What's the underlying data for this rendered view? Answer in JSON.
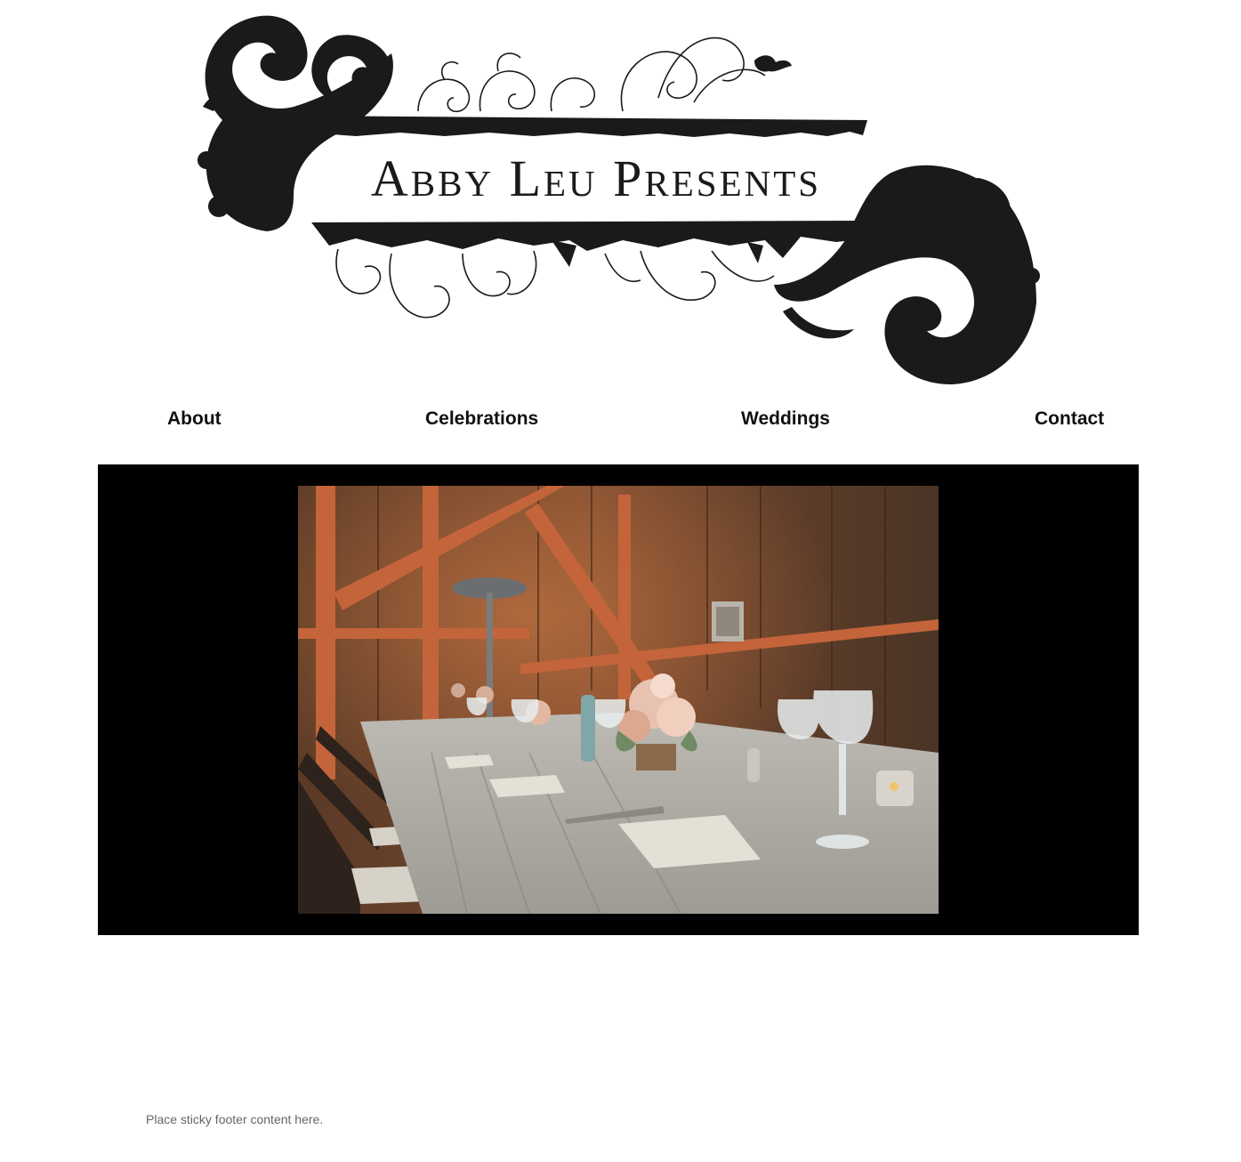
{
  "header": {
    "logo_text": "Abby Leu Presents"
  },
  "nav": {
    "items": [
      {
        "label": "About"
      },
      {
        "label": "Celebrations"
      },
      {
        "label": "Weddings"
      },
      {
        "label": "Contact"
      }
    ]
  },
  "slideshow": {
    "photo_icon": "banquet-table-photo"
  },
  "footer": {
    "text": "Place sticky footer content here."
  },
  "colors": {
    "logo": "#1a1a1a",
    "slideshow_bg": "#000000",
    "footer_text": "#666666"
  }
}
